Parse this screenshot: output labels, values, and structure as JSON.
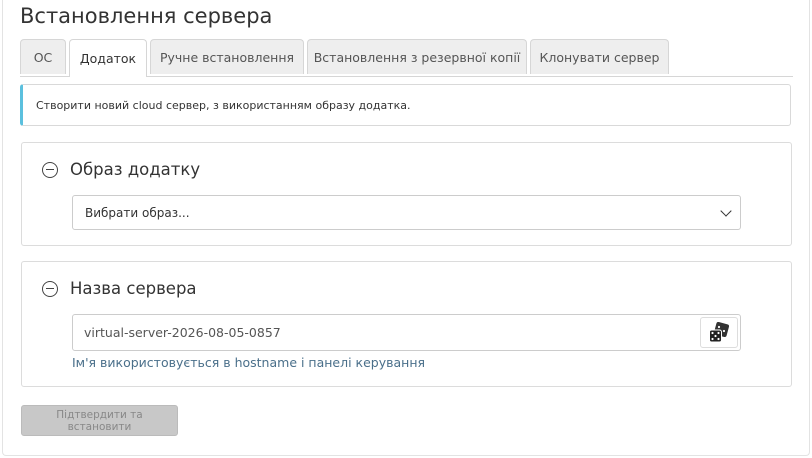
{
  "page": {
    "title": "Встановлення сервера"
  },
  "tabs": [
    {
      "label": "ОС",
      "active": false
    },
    {
      "label": "Додаток",
      "active": true
    },
    {
      "label": "Ручне встановлення",
      "active": false
    },
    {
      "label": "Встановлення з резервної копії",
      "active": false
    },
    {
      "label": "Клонувати сервер",
      "active": false
    }
  ],
  "alert": {
    "text": "Створити новий cloud сервер, з використанням образу додатка."
  },
  "app_image_panel": {
    "title": "Образ додатку",
    "select_value": "Вибрати образ...",
    "icon": "circle-minus-icon"
  },
  "server_name_panel": {
    "title": "Назва сервера",
    "input_value": "virtual-server-2026-08-05-0857",
    "help": "Ім'я використовується в hostname і панелі керування",
    "icon": "circle-minus-icon",
    "action_icon": "dice-icon"
  },
  "submit_label": "Підтвердити та встановити",
  "colors": {
    "info_border": "#5bc0de",
    "help_text": "#4a6f8a",
    "disabled_button": "#c8c8c8"
  }
}
